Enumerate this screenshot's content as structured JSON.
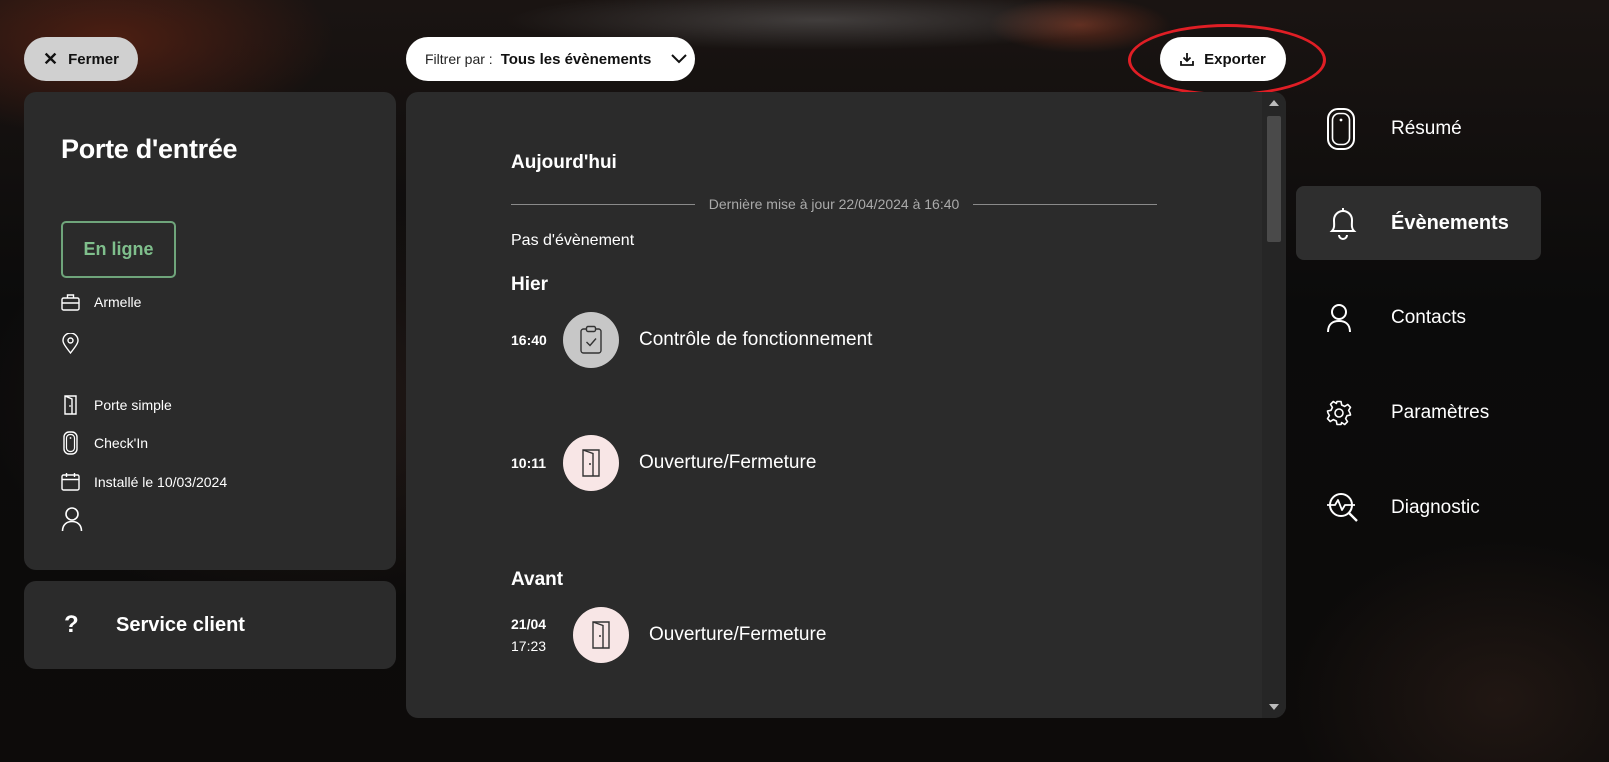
{
  "top": {
    "close_label": "Fermer",
    "filter_label": "Filtrer par :",
    "filter_value": "Tous les évènements",
    "export_label": "Exporter"
  },
  "device": {
    "title": "Porte d'entrée",
    "status": "En ligne",
    "owner": "Armelle",
    "location": "",
    "door_type": "Porte simple",
    "sensor": "Check'In",
    "installed": "Installé le 10/03/2024",
    "contact": ""
  },
  "service": {
    "label": "Service client"
  },
  "events": {
    "today_title": "Aujourd'hui",
    "last_update": "Dernière mise à jour 22/04/2024 à 16:40",
    "no_event": "Pas d'évènement",
    "yesterday_title": "Hier",
    "before_title": "Avant",
    "items": [
      {
        "date": "",
        "time": "16:40",
        "label": "Contrôle de fonctionnement",
        "icon": "clipboard-check-icon"
      },
      {
        "date": "",
        "time": "10:11",
        "label": "Ouverture/Fermeture",
        "icon": "door-icon"
      },
      {
        "date": "21/04",
        "time": "17:23",
        "label": "Ouverture/Fermeture",
        "icon": "door-icon"
      }
    ]
  },
  "nav": {
    "items": [
      {
        "label": "Résumé",
        "icon": "sensor-icon"
      },
      {
        "label": "Évènements",
        "icon": "bell-icon",
        "active": true
      },
      {
        "label": "Contacts",
        "icon": "person-icon"
      },
      {
        "label": "Paramètres",
        "icon": "gear-icon"
      },
      {
        "label": "Diagnostic",
        "icon": "diagnostic-icon"
      }
    ]
  },
  "colors": {
    "status_green": "#7fbf8c",
    "highlight_red": "#e01e25",
    "panel": "#2b2b2b"
  }
}
